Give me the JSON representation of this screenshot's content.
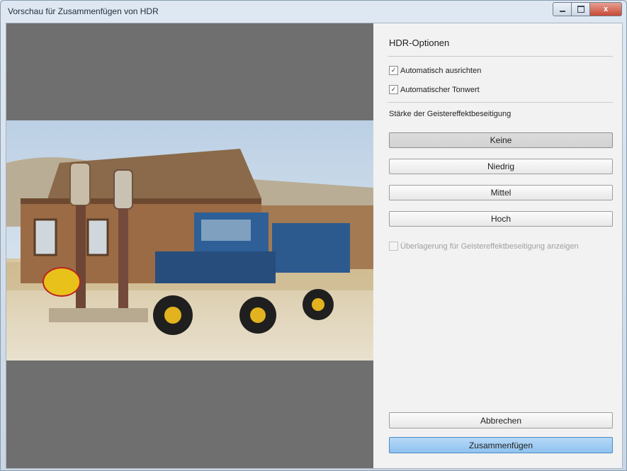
{
  "window": {
    "title": "Vorschau für Zusammenfügen von HDR",
    "minimize_icon": "minimize-icon",
    "maximize_icon": "maximize-icon",
    "close_icon": "close-icon",
    "close_glyph": "x"
  },
  "preview": {
    "image": "HDR preview photo"
  },
  "panel": {
    "heading": "HDR-Optionen",
    "auto_align": {
      "label": "Automatisch ausrichten",
      "checked": true
    },
    "auto_tone": {
      "label": "Automatischer Tonwert",
      "checked": true
    },
    "deghost_label": "Stärke der Geistereffektbeseitigung",
    "deghost_options": [
      {
        "label": "Keine",
        "selected": true
      },
      {
        "label": "Niedrig",
        "selected": false
      },
      {
        "label": "Mittel",
        "selected": false
      },
      {
        "label": "Hoch",
        "selected": false
      }
    ],
    "overlay": {
      "label": "Überlagerung für Geistereffektbeseitigung anzeigen",
      "checked": false,
      "enabled": false
    },
    "cancel_label": "Abbrechen",
    "merge_label": "Zusammenfügen"
  },
  "colors": {
    "preview_bg": "#6f6f6f",
    "primary_button": "#8fc3ef",
    "close_button": "#c74a35"
  }
}
